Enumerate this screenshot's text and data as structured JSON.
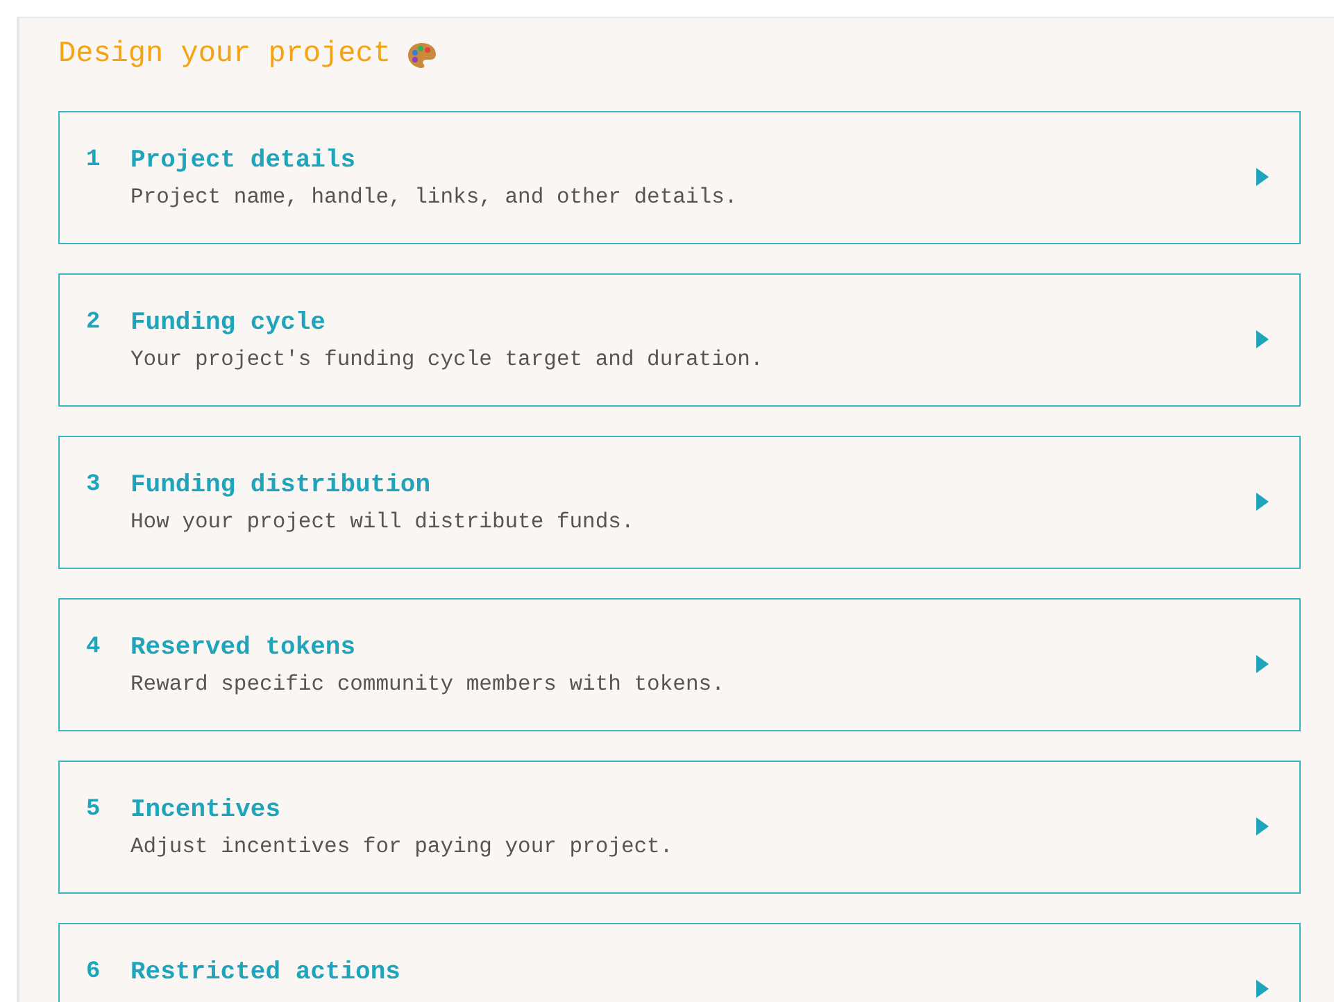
{
  "heading": "Design your project",
  "steps": [
    {
      "number": "1",
      "title": "Project details",
      "description": "Project name, handle, links, and other details."
    },
    {
      "number": "2",
      "title": "Funding cycle",
      "description": "Your project's funding cycle target and duration."
    },
    {
      "number": "3",
      "title": "Funding distribution",
      "description": "How your project will distribute funds."
    },
    {
      "number": "4",
      "title": "Reserved tokens",
      "description": "Reward specific community members with tokens."
    },
    {
      "number": "5",
      "title": "Incentives",
      "description": "Adjust incentives for paying your project."
    },
    {
      "number": "6",
      "title": "Restricted actions"
    }
  ]
}
